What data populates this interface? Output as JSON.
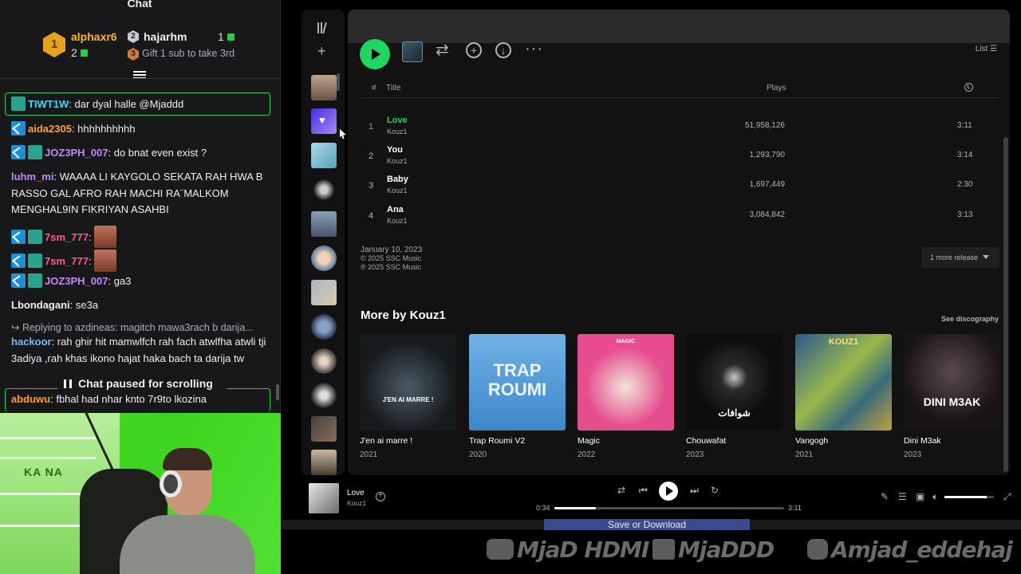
{
  "chat": {
    "title": "Chat",
    "leaderboard": {
      "first": {
        "rank": "1",
        "name": "alphaxr6",
        "count": "2"
      },
      "second": {
        "rank": "2",
        "name": "hajarhm",
        "count": "1"
      },
      "third": {
        "rank": "3",
        "text": "Gift 1 sub to take 3rd"
      }
    },
    "messages": [
      {
        "user": "TIWT1W",
        "text": ": dar dyal halle @Mjaddd"
      },
      {
        "user": "aida2305",
        "text": ": hhhhhhhhhh"
      },
      {
        "user": "JOZ3PH_007",
        "text": ": do bnat even exist ?"
      },
      {
        "user": "luhm_mi",
        "text": ": WAAAA LI KAYGOLO SEKATA RAH HWA B RASSO GAL AFRO RAH MACHI RA¨MALKOM MENGHAL9IN FIKRIYAN ASAHBI"
      },
      {
        "user": "7sm_777",
        "text": ":"
      },
      {
        "user": "7sm_777",
        "text": ":"
      },
      {
        "user": "JOZ3PH_007",
        "text": ": ga3"
      },
      {
        "user": "Lbondagani",
        "text": ": se3a"
      },
      {
        "reply": "Replying to azdineas: magitch mawa3rach b darija..."
      },
      {
        "user": "hackoor",
        "text": ": rah ghir hit mamwlfch rah fach atwlfha atwli tji 3adiya ,rah khas ikono hajat haka bach ta darija tw"
      },
      {
        "user": "abduwu",
        "text": ": fbhal had nhar knto 7r9to lkozina"
      }
    ],
    "paused": "Chat paused for scrolling"
  },
  "webcam": {
    "shelf_text": "KA  NA"
  },
  "spotify": {
    "list_label": "List",
    "headers": {
      "num": "#",
      "title": "Title",
      "plays": "Plays"
    },
    "tracks": [
      {
        "num": "1",
        "title": "Love",
        "artist": "Kouz1",
        "plays": "51,958,126",
        "duration": "3:11",
        "active": true
      },
      {
        "num": "2",
        "title": "You",
        "artist": "Kouz1",
        "plays": "1,293,790",
        "duration": "3:14"
      },
      {
        "num": "3",
        "title": "Baby",
        "artist": "Kouz1",
        "plays": "1,697,449",
        "duration": "2:30"
      },
      {
        "num": "4",
        "title": "Ana",
        "artist": "Kouz1",
        "plays": "3,084,842",
        "duration": "3:13"
      }
    ],
    "release": {
      "date": "January 10, 2023",
      "copyright": "© 2025 SSC Music",
      "phonogram": "℗ 2025 SSC Music"
    },
    "more_releases": "1 more release",
    "more_by": "More by Kouz1",
    "see_discography": "See discography",
    "albums": [
      {
        "name": "J'en ai marre !",
        "year": "2021",
        "cover_text": "J'EN AI MARRE !",
        "bg": "#151a1d"
      },
      {
        "name": "Trap Roumi V2",
        "year": "2020",
        "cover_text": "TRAP ROUMI",
        "bg": "#4f96d4"
      },
      {
        "name": "Magic",
        "year": "2022",
        "cover_text": "MAGIC",
        "bg": "#e64e8f"
      },
      {
        "name": "Chouwafat",
        "year": "2023",
        "cover_text": "شوافات",
        "bg": "#0d0d0d"
      },
      {
        "name": "Vangogh",
        "year": "2021",
        "cover_text": "KOUZ1",
        "bg": "#3b6b7a"
      },
      {
        "name": "Dini M3ak",
        "year": "2023",
        "cover_text": "DINI M3AK",
        "bg": "#1a1416"
      }
    ],
    "now_playing": {
      "title": "Love",
      "artist": "Kouz1",
      "current": "0:34",
      "total": "3:11",
      "progress": 0.18,
      "volume": 0.85
    }
  },
  "overlay": {
    "save_button": "Save or Download",
    "watermarks": [
      "MjaD HDMI",
      "MjaDDD",
      "Amjad_eddehaj"
    ]
  },
  "colors": {
    "spotify_green": "#1ed760",
    "chat_highlight": "#34c759",
    "twitch_bg": "#18181b"
  }
}
